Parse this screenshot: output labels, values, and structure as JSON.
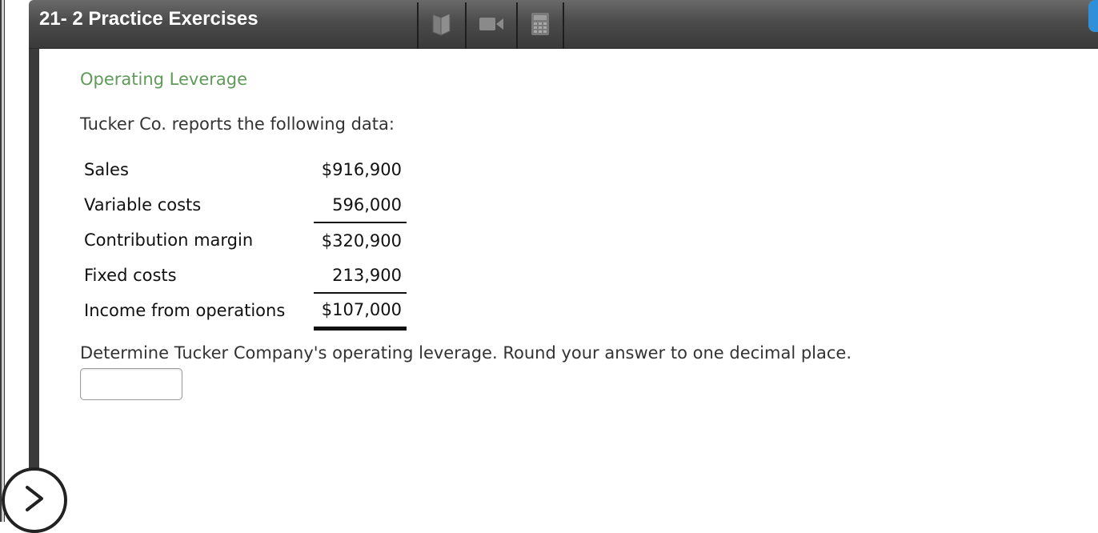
{
  "header": {
    "title": "21- 2 Practice Exercises",
    "tools": [
      {
        "icon": "book-icon"
      },
      {
        "icon": "video-icon"
      },
      {
        "icon": "calculator-icon"
      }
    ]
  },
  "content": {
    "section_title": "Operating Leverage",
    "intro": "Tucker Co. reports the following data:",
    "rows": [
      {
        "label": "Sales",
        "value": "$916,900"
      },
      {
        "label": "Variable costs",
        "value": "596,000"
      },
      {
        "label": "Contribution margin",
        "value": "$320,900"
      },
      {
        "label": "Fixed costs",
        "value": "213,900"
      },
      {
        "label": "Income from operations",
        "value": "$107,000"
      }
    ],
    "question": "Determine Tucker Company's operating leverage. Round your answer to one decimal place.",
    "answer": {
      "value": "",
      "placeholder": ""
    }
  },
  "nav": {
    "next_icon": "chevron-right-icon"
  },
  "colors": {
    "header": "#4b4b4b",
    "accent_green": "#5f9a58",
    "side_tab_blue": "#2f8fd8"
  }
}
